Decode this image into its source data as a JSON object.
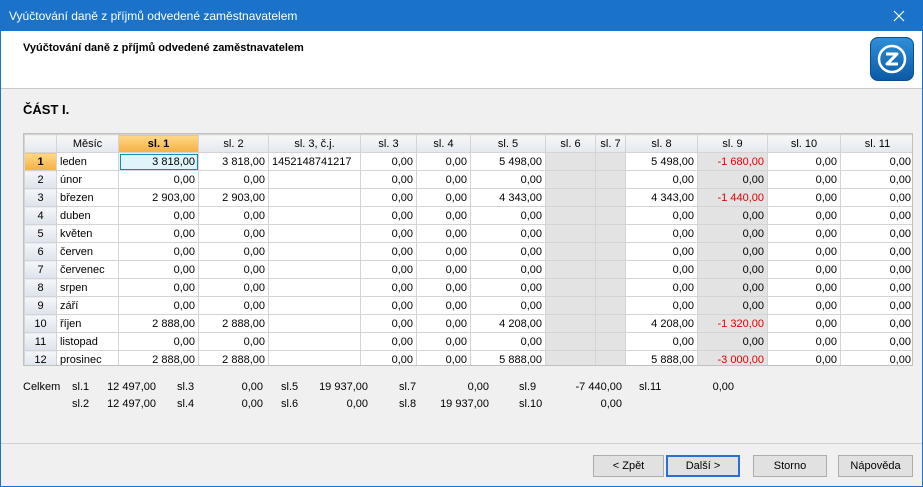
{
  "window": {
    "title": "Vyúčtování daně z příjmů odvedené zaměstnavatelem"
  },
  "header": {
    "title": "Vyúčtování daně z příjmů odvedené zaměstnavatelem",
    "logo_icon": "z-logo-icon"
  },
  "section_label": "ČÁST I.",
  "grid": {
    "columns": [
      "Měsíc",
      "sl. 1",
      "sl. 2",
      "sl. 3, č.j.",
      "sl. 3",
      "sl. 4",
      "sl. 5",
      "sl. 6",
      "sl. 7",
      "sl. 8",
      "sl. 9",
      "sl. 10",
      "sl. 11"
    ],
    "rows": [
      {
        "n": "1",
        "m": "leden",
        "c": [
          "3 818,00",
          "3 818,00",
          "1452148741217",
          "0,00",
          "0,00",
          "5 498,00",
          "",
          "",
          "5 498,00",
          "-1 680,00",
          "0,00",
          "0,00"
        ]
      },
      {
        "n": "2",
        "m": "únor",
        "c": [
          "0,00",
          "0,00",
          "",
          "0,00",
          "0,00",
          "0,00",
          "",
          "",
          "0,00",
          "0,00",
          "0,00",
          "0,00"
        ]
      },
      {
        "n": "3",
        "m": "březen",
        "c": [
          "2 903,00",
          "2 903,00",
          "",
          "0,00",
          "0,00",
          "4 343,00",
          "",
          "",
          "4 343,00",
          "-1 440,00",
          "0,00",
          "0,00"
        ]
      },
      {
        "n": "4",
        "m": "duben",
        "c": [
          "0,00",
          "0,00",
          "",
          "0,00",
          "0,00",
          "0,00",
          "",
          "",
          "0,00",
          "0,00",
          "0,00",
          "0,00"
        ]
      },
      {
        "n": "5",
        "m": "květen",
        "c": [
          "0,00",
          "0,00",
          "",
          "0,00",
          "0,00",
          "0,00",
          "",
          "",
          "0,00",
          "0,00",
          "0,00",
          "0,00"
        ]
      },
      {
        "n": "6",
        "m": "červen",
        "c": [
          "0,00",
          "0,00",
          "",
          "0,00",
          "0,00",
          "0,00",
          "",
          "",
          "0,00",
          "0,00",
          "0,00",
          "0,00"
        ]
      },
      {
        "n": "7",
        "m": "červenec",
        "c": [
          "0,00",
          "0,00",
          "",
          "0,00",
          "0,00",
          "0,00",
          "",
          "",
          "0,00",
          "0,00",
          "0,00",
          "0,00"
        ]
      },
      {
        "n": "8",
        "m": "srpen",
        "c": [
          "0,00",
          "0,00",
          "",
          "0,00",
          "0,00",
          "0,00",
          "",
          "",
          "0,00",
          "0,00",
          "0,00",
          "0,00"
        ]
      },
      {
        "n": "9",
        "m": "září",
        "c": [
          "0,00",
          "0,00",
          "",
          "0,00",
          "0,00",
          "0,00",
          "",
          "",
          "0,00",
          "0,00",
          "0,00",
          "0,00"
        ]
      },
      {
        "n": "10",
        "m": "říjen",
        "c": [
          "2 888,00",
          "2 888,00",
          "",
          "0,00",
          "0,00",
          "4 208,00",
          "",
          "",
          "4 208,00",
          "-1 320,00",
          "0,00",
          "0,00"
        ]
      },
      {
        "n": "11",
        "m": "listopad",
        "c": [
          "0,00",
          "0,00",
          "",
          "0,00",
          "0,00",
          "0,00",
          "",
          "",
          "0,00",
          "0,00",
          "0,00",
          "0,00"
        ]
      },
      {
        "n": "12",
        "m": "prosinec",
        "c": [
          "2 888,00",
          "2 888,00",
          "",
          "0,00",
          "0,00",
          "5 888,00",
          "",
          "",
          "5 888,00",
          "-3 000,00",
          "0,00",
          "0,00"
        ]
      }
    ]
  },
  "totals": {
    "label": "Celkem",
    "row1": [
      {
        "l": "sl.1",
        "v": "12 497,00"
      },
      {
        "l": "sl.3",
        "v": "0,00"
      },
      {
        "l": "sl.5",
        "v": "19 937,00"
      },
      {
        "l": "sl.7",
        "v": "0,00"
      },
      {
        "l": "sl.9",
        "v": "-7 440,00"
      },
      {
        "l": "sl.11",
        "v": "0,00"
      }
    ],
    "row2": [
      {
        "l": "sl.2",
        "v": "12 497,00"
      },
      {
        "l": "sl.4",
        "v": "0,00"
      },
      {
        "l": "sl.6",
        "v": "0,00"
      },
      {
        "l": "sl.8",
        "v": "19 937,00"
      },
      {
        "l": "sl.10",
        "v": "0,00"
      }
    ]
  },
  "buttons": {
    "back": "< Zpět",
    "next": "Další >",
    "cancel": "Storno",
    "help": "Nápověda"
  },
  "colors": {
    "titlebar": "#1a73c9",
    "active_header": "#f4b042",
    "negative": "#e00000",
    "gray_cell": "#e3e3e3"
  }
}
